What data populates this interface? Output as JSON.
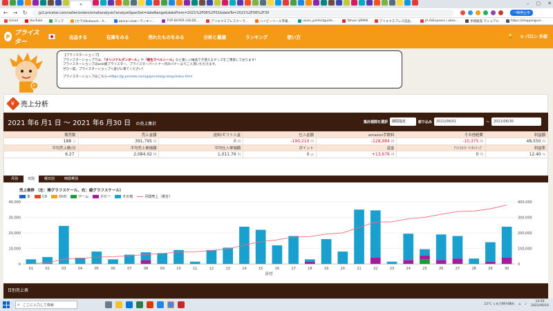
{
  "browser": {
    "url": "jp2.pricetar.com/seller/orders/smallanalysis?analyzeSpanSet=dateRange&dateFrom=2021%2F06%2F01&dateTo=2021%2F06%2F30",
    "pause_label": "一時停止中",
    "bookmarks": [
      "Gmail",
      "YouTube",
      "マップ",
      "[セラ]Okatwork - A...",
      "ebiirai sisatーランキン...",
      "TOP BUYER GOLDE...",
      "アリエクスプレスクーラ...",
      "ハイピーツール市場...",
      "raisin_perfectguide...",
      "Yahoo! JAPAN",
      "アリエクスプレス店品...",
      "JA.AliExpress | aliex...",
      "手続販売 マニュアル",
      "https://shoppingcor..."
    ]
  },
  "site": {
    "logo_text": "プライスター",
    "menu": [
      "出品する",
      "在庫をみる",
      "売れたものをみる",
      "分析と最適",
      "ランキング",
      "使い方"
    ],
    "notification_label": "",
    "settings_label": "パロン 外部"
  },
  "notice": {
    "title": "【プライスターショップ】",
    "line1_pre": "プライスターショップでは、",
    "line1_hl1": "「オリジナルダンボール」",
    "line1_mid": "や",
    "line1_hl2": "「梱包ラベルシール」",
    "line1_post": "など素しい納品でき使えるグッズをご用意しております！",
    "line2": "プライスターショップはweb版プライスター、プライスターパートナー内のバナーよりご入頂いただけます。",
    "line3": "ぜひ一度、プライスターショップへ遊びに来てください！",
    "link_pre": "プライスターショップはこちら→",
    "link_url": "https://jp.pricetar.com/jp/pricetarjp-shop/index.html"
  },
  "analysis": {
    "title": "売上分析",
    "range_prefix": "2021",
    "range_text": "2021 年6 月1 日 ～ 2021 年6 月30 日",
    "range_label": "の売上集計",
    "filter_label": "集計期間を選択",
    "period_select": "期間指定",
    "narrow_label": "絞り込み",
    "date_from": "2021/06/01",
    "date_to": "2021/06/30",
    "tilde": "～"
  },
  "stats": {
    "row1_headers": [
      "販売数",
      "売上金額",
      "送料/ギフト入金",
      "仕入金額",
      "amazon手数料",
      "その他経費",
      "利益額"
    ],
    "row1_values": [
      {
        "v": "188",
        "u": "コ",
        "neg": false
      },
      {
        "v": "391,795",
        "u": "円",
        "neg": false
      },
      {
        "v": "0",
        "u": "円",
        "neg": false
      },
      {
        "v": "-190,210",
        "u": "円",
        "neg": true
      },
      {
        "v": "-128,984",
        "u": "円",
        "neg": true
      },
      {
        "v": "-10,375",
        "u": "円",
        "neg": true
      },
      {
        "v": "48,550",
        "u": "円",
        "neg": false
      }
    ],
    "row2_headers": [
      "平均売上数/日",
      "平均売上単価額",
      "平均仕入単価額",
      "ポイント",
      "返金",
      "ｱﾌｨﾘｴｲﾄ ｲﾝｾﾝﾃｨﾌﾞ",
      "利益率"
    ],
    "row2_values": [
      {
        "v": "6.27",
        "u": "",
        "neg": false
      },
      {
        "v": "2,084.02",
        "u": "円",
        "neg": false
      },
      {
        "v": "1,011.76",
        "u": "円",
        "neg": false
      },
      {
        "v": "0",
        "u": "pt",
        "neg": false
      },
      {
        "v": "+13,676",
        "u": "円",
        "neg": true
      },
      {
        "v": "0",
        "u": "円",
        "neg": false
      },
      {
        "v": "12.40",
        "u": "%",
        "neg": false
      }
    ]
  },
  "tabs": [
    "月別",
    "日別",
    "曜日別",
    "時間帯別"
  ],
  "chart_data": {
    "type": "bar",
    "title": "売上推移 （左：棒グラフスケール、右：線グラフスケール）",
    "xlabel": "日付",
    "categories": [
      "01",
      "02",
      "03",
      "04",
      "05",
      "06",
      "07",
      "08",
      "09",
      "10",
      "11",
      "12",
      "13",
      "14",
      "15",
      "16",
      "17",
      "18",
      "19",
      "20",
      "21",
      "22",
      "23",
      "24",
      "25",
      "26",
      "27",
      "28",
      "29",
      "30"
    ],
    "ylim_left": [
      0,
      40000
    ],
    "ylim_right": [
      0,
      400000
    ],
    "yticks_left": [
      "0",
      "10,000",
      "20,000",
      "30,000",
      "40,000"
    ],
    "yticks_right": [
      "0",
      "100,000",
      "200,000",
      "300,000",
      "400,000"
    ],
    "legend": [
      "本",
      "CD",
      "DVD",
      "ゲーム",
      "ホビー",
      "その他",
      "月間売上（累計）"
    ],
    "colors": {
      "本": "#1f5fc4",
      "CD": "#e8441f",
      "DVD": "#f5a31a",
      "ゲーム": "#1e9a35",
      "ホビー": "#a31c9e",
      "その他": "#1aa0cf",
      "月間売上（累計）": "#f06a7a"
    },
    "series": [
      {
        "name": "本",
        "values": [
          0,
          0,
          0,
          0,
          0,
          0,
          0,
          0,
          0,
          0,
          0,
          0,
          0,
          0,
          0,
          0,
          0,
          0,
          0,
          0,
          0,
          0,
          0,
          0,
          0,
          0,
          0,
          0,
          0,
          0
        ]
      },
      {
        "name": "ゲーム",
        "values": [
          0,
          0,
          0,
          0,
          0,
          0,
          0,
          0,
          0,
          0,
          0,
          0,
          0,
          0,
          0,
          0,
          0,
          0,
          0,
          0,
          0,
          0,
          0,
          0,
          3000,
          0,
          0,
          0,
          0,
          0
        ]
      },
      {
        "name": "ホビー",
        "values": [
          0,
          0,
          0,
          0,
          0,
          0,
          0,
          2500,
          0,
          0,
          0,
          0,
          0,
          0,
          0,
          0,
          0,
          1500,
          0,
          0,
          0,
          4000,
          0,
          2500,
          2500,
          2500,
          3500,
          0,
          1500,
          4000
        ]
      },
      {
        "name": "その他",
        "values": [
          3000,
          4500,
          24500,
          4000,
          8000,
          3000,
          6000,
          5000,
          7000,
          9000,
          1500,
          9000,
          10500,
          24000,
          22000,
          12000,
          18000,
          1500,
          16000,
          8000,
          35000,
          30500,
          1500,
          17000,
          4000,
          16500,
          14500,
          3500,
          12500,
          20000
        ]
      }
    ],
    "line_series": {
      "name": "月間売上（累計）",
      "values": [
        3000,
        7500,
        32000,
        36000,
        44000,
        47000,
        53000,
        60500,
        67500,
        76500,
        78000,
        87000,
        97500,
        121500,
        143500,
        155500,
        173500,
        176500,
        192500,
        200500,
        235500,
        270000,
        271500,
        291000,
        300500,
        319500,
        337500,
        341000,
        355000,
        379000
      ]
    }
  },
  "bottom_panel_title": "日別売上表",
  "taskbar": {
    "search_placeholder": "ここに入力して検索",
    "weather": "23°C くもり時々晴れ",
    "time": "14:30",
    "date": "2022/06/16"
  }
}
